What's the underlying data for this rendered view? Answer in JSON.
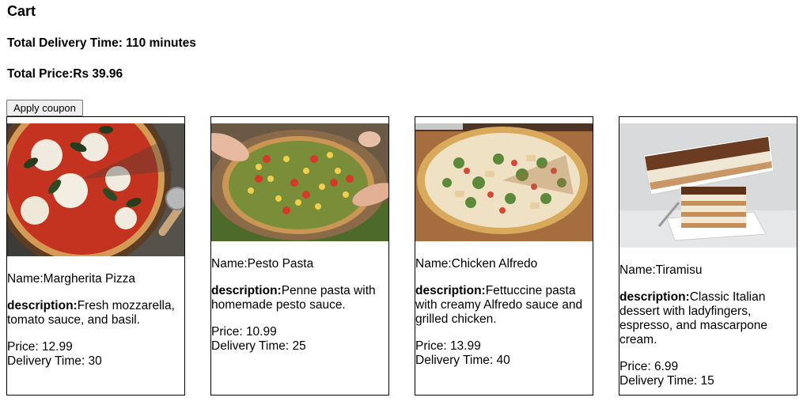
{
  "cart": {
    "title": "Cart",
    "total_delivery_label": "Total Delivery Time:",
    "total_delivery_value": " 110 minutes",
    "total_price_label": "Total Price:",
    "total_price_value": "Rs 39.96",
    "coupon_button": "Apply coupon"
  },
  "items": [
    {
      "name_label": "Name:",
      "name": "Margherita Pizza",
      "desc_label": "description:",
      "description": "Fresh mozzarella, tomato sauce, and basil.",
      "price_label": "Price: ",
      "price": "12.99",
      "delivery_label": "Delivery Time: ",
      "delivery": "30",
      "image_icon": "margherita-pizza-photo"
    },
    {
      "name_label": "Name:",
      "name": "Pesto Pasta",
      "desc_label": "description:",
      "description": "Penne pasta with homemade pesto sauce.",
      "price_label": "Price: ",
      "price": "10.99",
      "delivery_label": "Delivery Time: ",
      "delivery": "25",
      "image_icon": "pesto-pizza-photo"
    },
    {
      "name_label": "Name:",
      "name": "Chicken Alfredo",
      "desc_label": "description:",
      "description": "Fettuccine pasta with creamy Alfredo sauce and grilled chicken.",
      "price_label": "Price: ",
      "price": "13.99",
      "delivery_label": "Delivery Time: ",
      "delivery": "40",
      "image_icon": "chicken-alfredo-pizza-photo"
    },
    {
      "name_label": "Name:",
      "name": "Tiramisu",
      "desc_label": "description:",
      "description": "Classic Italian dessert with ladyfingers, espresso, and mascarpone cream.",
      "price_label": "Price: ",
      "price": "6.99",
      "delivery_label": "Delivery Time: ",
      "delivery": "15",
      "image_icon": "tiramisu-photo"
    }
  ]
}
